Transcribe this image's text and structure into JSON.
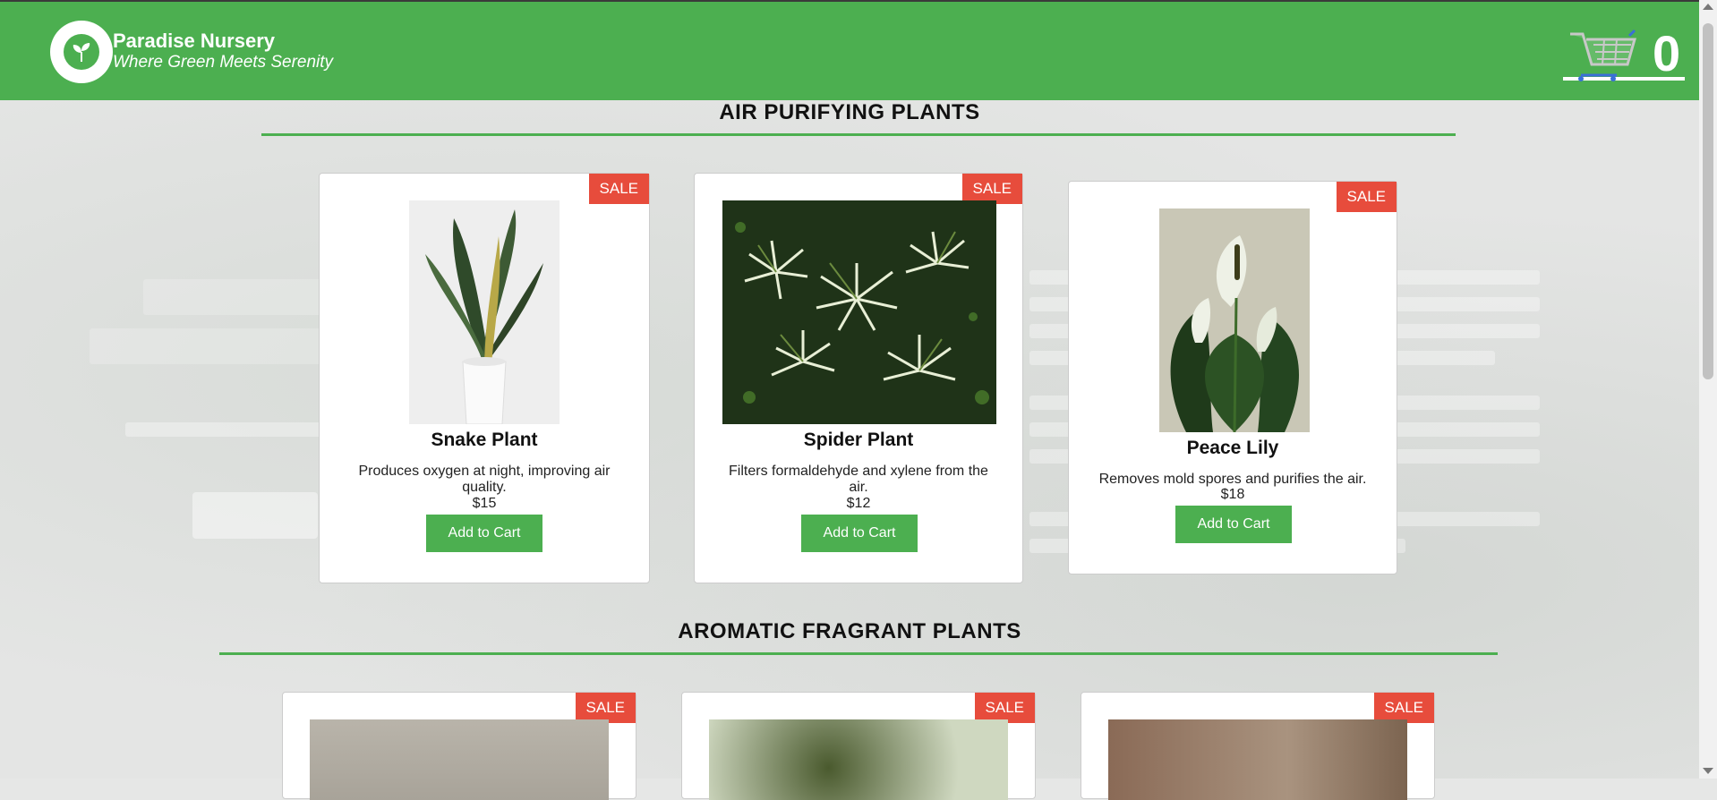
{
  "header": {
    "brand_name": "Paradise Nursery",
    "tagline": "Where Green Meets Serenity",
    "cart_count": "0",
    "cart_icon": "shopping-cart-icon",
    "logo_icon": "leaf-logo-icon"
  },
  "colors": {
    "primary": "#4caf50",
    "sale": "#e74c3c"
  },
  "sections": [
    {
      "title": "AIR PURIFYING PLANTS",
      "plants": [
        {
          "sale": "SALE",
          "name": "Snake Plant",
          "description": "Produces oxygen at night, improving air quality.",
          "price": "$15",
          "button": "Add to Cart"
        },
        {
          "sale": "SALE",
          "name": "Spider Plant",
          "description": "Filters formaldehyde and xylene from the air.",
          "price": "$12",
          "button": "Add to Cart"
        },
        {
          "sale": "SALE",
          "name": "Peace Lily",
          "description": "Removes mold spores and purifies the air.",
          "price": "$18",
          "button": "Add to Cart"
        }
      ]
    },
    {
      "title": "AROMATIC FRAGRANT PLANTS",
      "plants": [
        {
          "sale": "SALE"
        },
        {
          "sale": "SALE"
        },
        {
          "sale": "SALE"
        }
      ]
    }
  ]
}
